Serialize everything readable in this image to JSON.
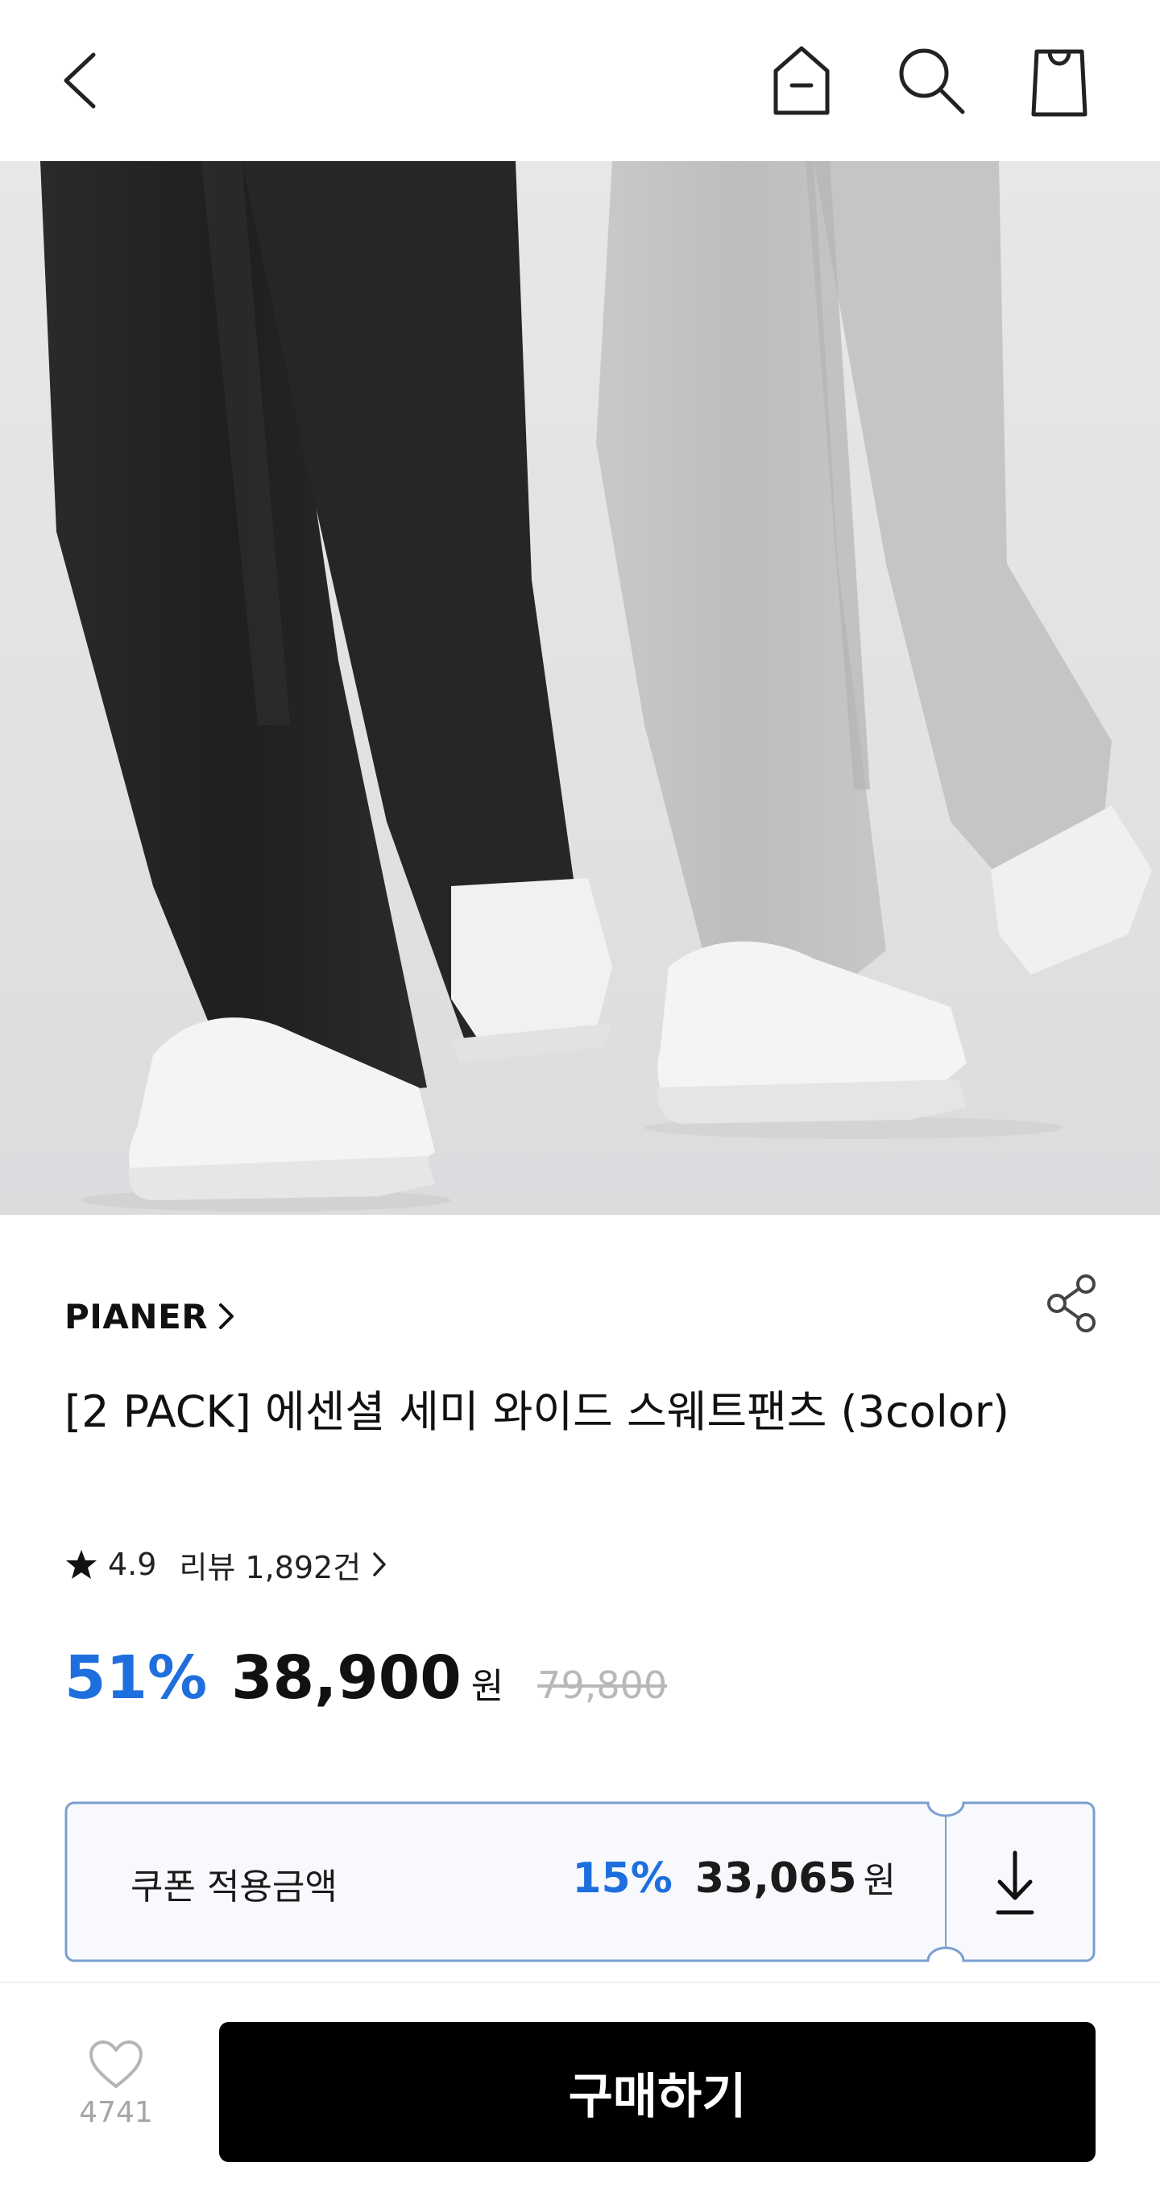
{
  "colors": {
    "accent": "#1e6fdd",
    "buy_button": "#000000",
    "coupon_border": "#7b9fd0",
    "coupon_bg": "#f7f9fd"
  },
  "header": {
    "icons": [
      "chevron-left-icon",
      "home-icon",
      "search-icon",
      "shopping-bag-icon"
    ]
  },
  "product": {
    "brand": "PIANER",
    "title": "[2 PACK] 에센셜 세미 와이드 스웨트팬츠 (3color)",
    "rating": "4.9",
    "review_text": "리뷰 1,892건",
    "discount": "51%",
    "price": "38,900",
    "currency": "원",
    "original_price": "79,800"
  },
  "coupon": {
    "label": "쿠폰 적용금액",
    "discount": "15%",
    "price": "33,065",
    "currency": "원"
  },
  "bottom": {
    "like_count": "4741",
    "buy_label": "구매하기"
  }
}
